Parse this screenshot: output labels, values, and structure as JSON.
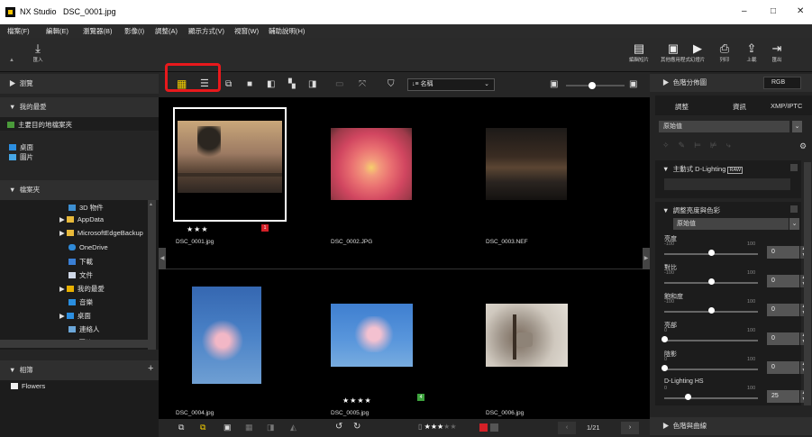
{
  "window": {
    "app": "NX Studio",
    "file": "DSC_0001.jpg",
    "minimize": "–",
    "maximize": "□",
    "close": "✕"
  },
  "menu": [
    "檔案(F)",
    "編輯(E)",
    "瀏覽器(B)",
    "影像(I)",
    "調整(A)",
    "顯示方式(V)",
    "視窗(W)",
    "輔助說明(H)"
  ],
  "toolbar": {
    "import_label": "匯入",
    "right_items": [
      "編輯短片",
      "其他應用程式",
      "幻燈片",
      "列印",
      "上載",
      "匯出"
    ]
  },
  "left": {
    "browse": "瀏覽",
    "favorites": "我的最愛",
    "favorites_add": "主要目的地檔案夾",
    "fav_items": [
      "桌面",
      "圖片"
    ],
    "folders": "檔案夾",
    "tree": [
      "3D 物件",
      "AppData",
      "MicrosoftEdgeBackup",
      "OneDrive",
      "下載",
      "文件",
      "我的最愛",
      "音樂",
      "桌面",
      "連絡人",
      "圖片"
    ],
    "albums": "相簿",
    "album_add": "+",
    "album_items": [
      "Flowers"
    ]
  },
  "center": {
    "sort_label": "名稱",
    "thumbs": [
      {
        "name": "DSC_0001.jpg",
        "stars": "★★★",
        "badge": "1",
        "badge_color": "#d42027"
      },
      {
        "name": "DSC_0002.JPG",
        "stars": "",
        "badge": "",
        "badge_color": ""
      },
      {
        "name": "DSC_0003.NEF",
        "stars": "",
        "badge": "",
        "badge_color": ""
      },
      {
        "name": "DSC_0004.jpg",
        "stars": "",
        "badge": "",
        "badge_color": ""
      },
      {
        "name": "DSC_0005.jpg",
        "stars": "★★★★",
        "badge": "4",
        "badge_color": "#3da33d"
      },
      {
        "name": "DSC_0006.jpg",
        "stars": "",
        "badge": "",
        "badge_color": ""
      }
    ],
    "bottom_rating": "★★★",
    "bottom_rating_empty": "★★",
    "page": "1/21"
  },
  "right": {
    "histogram": "色階分佈圖",
    "histogram_mode": "RGB",
    "tabs": [
      "調整",
      "資訊",
      "XMP/IPTC"
    ],
    "preset": "原始值",
    "adl": "主動式 D-Lighting",
    "adl_badge": "RAW",
    "bc_section": "調整亮度與色彩",
    "bc_preset": "原始值",
    "sliders": [
      {
        "label": "亮度",
        "min": "-100",
        "max": "100",
        "value": "0",
        "pos": 0.5
      },
      {
        "label": "對比",
        "min": "-100",
        "max": "100",
        "value": "0",
        "pos": 0.5
      },
      {
        "label": "飽和度",
        "min": "-100",
        "max": "100",
        "value": "0",
        "pos": 0.5
      },
      {
        "label": "亮部",
        "min": "0",
        "max": "100",
        "value": "0",
        "pos": 0.0
      },
      {
        "label": "陰影",
        "min": "0",
        "max": "100",
        "value": "0",
        "pos": 0.0
      },
      {
        "label": "D-Lighting HS",
        "min": "0",
        "max": "100",
        "value": "25",
        "pos": 0.25
      }
    ],
    "curves": "色階與曲線"
  }
}
